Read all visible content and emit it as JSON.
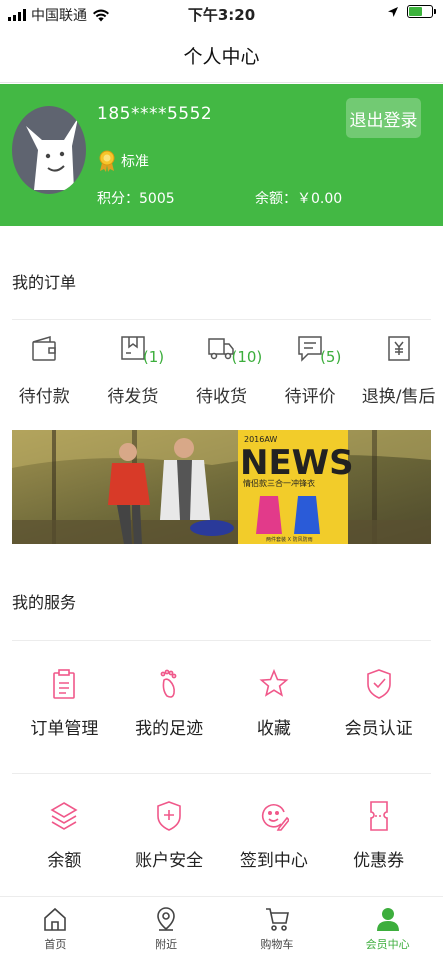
{
  "status_bar": {
    "carrier": "中国联通",
    "time": "下午3:20"
  },
  "header": {
    "title": "个人中心"
  },
  "profile": {
    "phone": "185****5552",
    "level": "标准",
    "points_label": "积分：5005",
    "balance_label": "余额：￥0.00",
    "logout_label": "退出登录"
  },
  "orders": {
    "title": "我的订单",
    "items": [
      {
        "label": "待付款",
        "count": "",
        "icon": "wallet-icon"
      },
      {
        "label": "待发货",
        "count": "(1)",
        "icon": "box-icon"
      },
      {
        "label": "待收货",
        "count": "(10)",
        "icon": "truck-icon"
      },
      {
        "label": "待评价",
        "count": "(5)",
        "icon": "comment-icon"
      },
      {
        "label": "退换/售后",
        "count": "",
        "icon": "refund-icon"
      }
    ]
  },
  "banner": {
    "headline": "NEWS",
    "season": "2016AW",
    "subtitle": "情侣款三合一冲锋衣",
    "caption": "两件套装 X 防风防雨"
  },
  "services": {
    "title": "我的服务",
    "items": [
      {
        "label": "订单管理",
        "icon": "clipboard-icon"
      },
      {
        "label": "我的足迹",
        "icon": "footprint-icon"
      },
      {
        "label": "收藏",
        "icon": "star-icon"
      },
      {
        "label": "会员认证",
        "icon": "shield-check-icon"
      },
      {
        "label": "余额",
        "icon": "layers-icon"
      },
      {
        "label": "账户安全",
        "icon": "shield-plus-icon"
      },
      {
        "label": "签到中心",
        "icon": "smile-pen-icon"
      },
      {
        "label": "优惠券",
        "icon": "coupon-icon"
      }
    ]
  },
  "tabbar": {
    "items": [
      {
        "label": "首页",
        "icon": "home-icon"
      },
      {
        "label": "附近",
        "icon": "location-pin-icon"
      },
      {
        "label": "购物车",
        "icon": "cart-icon"
      },
      {
        "label": "会员中心",
        "icon": "user-icon",
        "active": true
      }
    ]
  },
  "colors": {
    "brand_green": "#43b844",
    "accent_pink": "#f0588a",
    "count_green": "#3cae3c"
  },
  "battery_level": 0.6
}
